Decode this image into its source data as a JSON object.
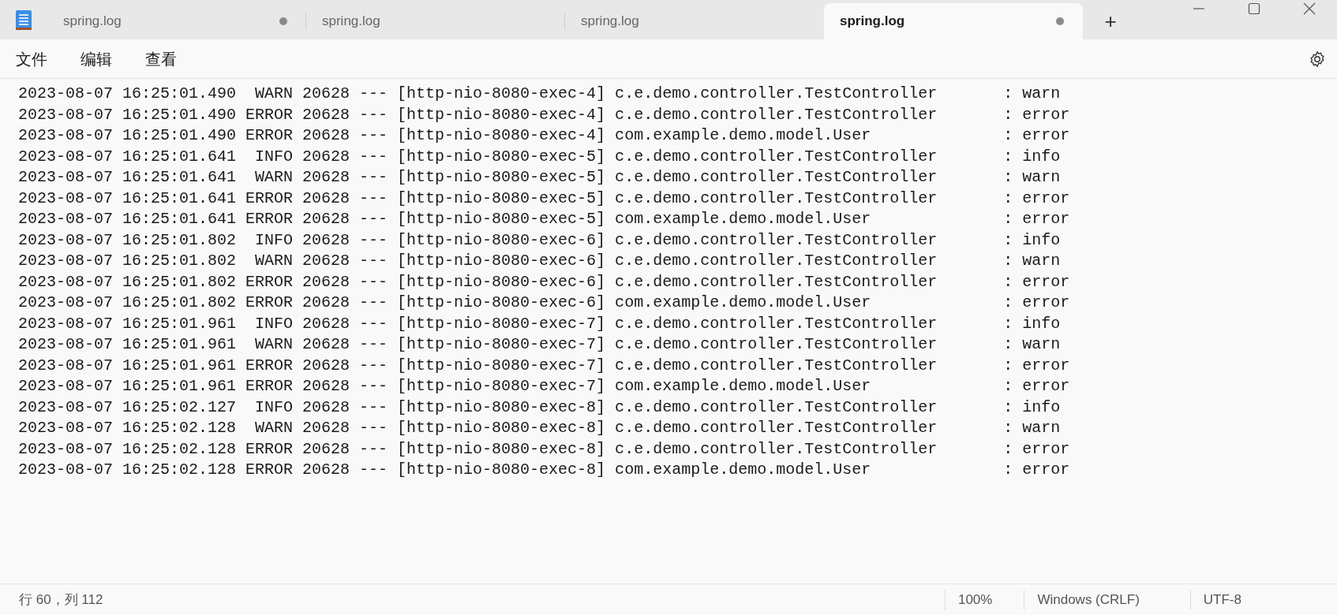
{
  "tabs": [
    {
      "label": "spring.log",
      "selected": false,
      "modified": true
    },
    {
      "label": "spring.log",
      "selected": false,
      "modified": false
    },
    {
      "label": "spring.log",
      "selected": false,
      "modified": false
    },
    {
      "label": "spring.log",
      "selected": true,
      "modified": true
    }
  ],
  "new_tab": "+",
  "menu": [
    "文件",
    "编辑",
    "查看"
  ],
  "lines": [
    "2023-08-07 16:25:01.490  WARN 20628 --- [http-nio-8080-exec-4] c.e.demo.controller.TestController       : warn",
    "2023-08-07 16:25:01.490 ERROR 20628 --- [http-nio-8080-exec-4] c.e.demo.controller.TestController       : error",
    "2023-08-07 16:25:01.490 ERROR 20628 --- [http-nio-8080-exec-4] com.example.demo.model.User              : error",
    "2023-08-07 16:25:01.641  INFO 20628 --- [http-nio-8080-exec-5] c.e.demo.controller.TestController       : info",
    "2023-08-07 16:25:01.641  WARN 20628 --- [http-nio-8080-exec-5] c.e.demo.controller.TestController       : warn",
    "2023-08-07 16:25:01.641 ERROR 20628 --- [http-nio-8080-exec-5] c.e.demo.controller.TestController       : error",
    "2023-08-07 16:25:01.641 ERROR 20628 --- [http-nio-8080-exec-5] com.example.demo.model.User              : error",
    "2023-08-07 16:25:01.802  INFO 20628 --- [http-nio-8080-exec-6] c.e.demo.controller.TestController       : info",
    "2023-08-07 16:25:01.802  WARN 20628 --- [http-nio-8080-exec-6] c.e.demo.controller.TestController       : warn",
    "2023-08-07 16:25:01.802 ERROR 20628 --- [http-nio-8080-exec-6] c.e.demo.controller.TestController       : error",
    "2023-08-07 16:25:01.802 ERROR 20628 --- [http-nio-8080-exec-6] com.example.demo.model.User              : error",
    "2023-08-07 16:25:01.961  INFO 20628 --- [http-nio-8080-exec-7] c.e.demo.controller.TestController       : info",
    "2023-08-07 16:25:01.961  WARN 20628 --- [http-nio-8080-exec-7] c.e.demo.controller.TestController       : warn",
    "2023-08-07 16:25:01.961 ERROR 20628 --- [http-nio-8080-exec-7] c.e.demo.controller.TestController       : error",
    "2023-08-07 16:25:01.961 ERROR 20628 --- [http-nio-8080-exec-7] com.example.demo.model.User              : error",
    "2023-08-07 16:25:02.127  INFO 20628 --- [http-nio-8080-exec-8] c.e.demo.controller.TestController       : info",
    "2023-08-07 16:25:02.128  WARN 20628 --- [http-nio-8080-exec-8] c.e.demo.controller.TestController       : warn",
    "2023-08-07 16:25:02.128 ERROR 20628 --- [http-nio-8080-exec-8] c.e.demo.controller.TestController       : error",
    "2023-08-07 16:25:02.128 ERROR 20628 --- [http-nio-8080-exec-8] com.example.demo.model.User              : error"
  ],
  "status_bar": {
    "position": "行 60，列 112",
    "zoom": "100%",
    "line_ending": "Windows (CRLF)",
    "encoding": "UTF-8"
  }
}
